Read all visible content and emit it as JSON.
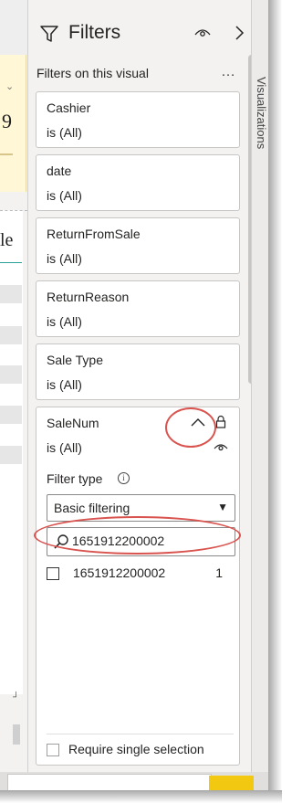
{
  "pane": {
    "title": "Filters",
    "section_label": "Filters on this visual",
    "more_label": "…"
  },
  "cards": [
    {
      "name": "Cashier",
      "state": "is (All)"
    },
    {
      "name": "date",
      "state": "is (All)"
    },
    {
      "name": "ReturnFromSale",
      "state": "is (All)"
    },
    {
      "name": "ReturnReason",
      "state": "is (All)"
    },
    {
      "name": "Sale Type",
      "state": "is (All)"
    }
  ],
  "expanded_card": {
    "name": "SaleNum",
    "state": "is (All)",
    "filter_type_label": "Filter type",
    "filter_type_value": "Basic filtering",
    "search_value": "1651912200002",
    "items": [
      {
        "label": "1651912200002",
        "count": "1"
      }
    ],
    "require_single_selection": "Require single selection"
  },
  "canvas": {
    "number_fragment": "9",
    "text_fragment": "le"
  },
  "viz_pane_label": "Visualizations",
  "colors": {
    "annotation": "#d9534f",
    "accent_yellow": "#f2c811",
    "pane_bg": "#f3f2f1"
  },
  "icons": {
    "filter": "filter-icon",
    "eye": "eye-icon",
    "chevron": "chevron-right-icon",
    "collapse": "chevron-up-icon",
    "lock": "lock-icon",
    "search": "search-icon",
    "info": "info-icon"
  }
}
